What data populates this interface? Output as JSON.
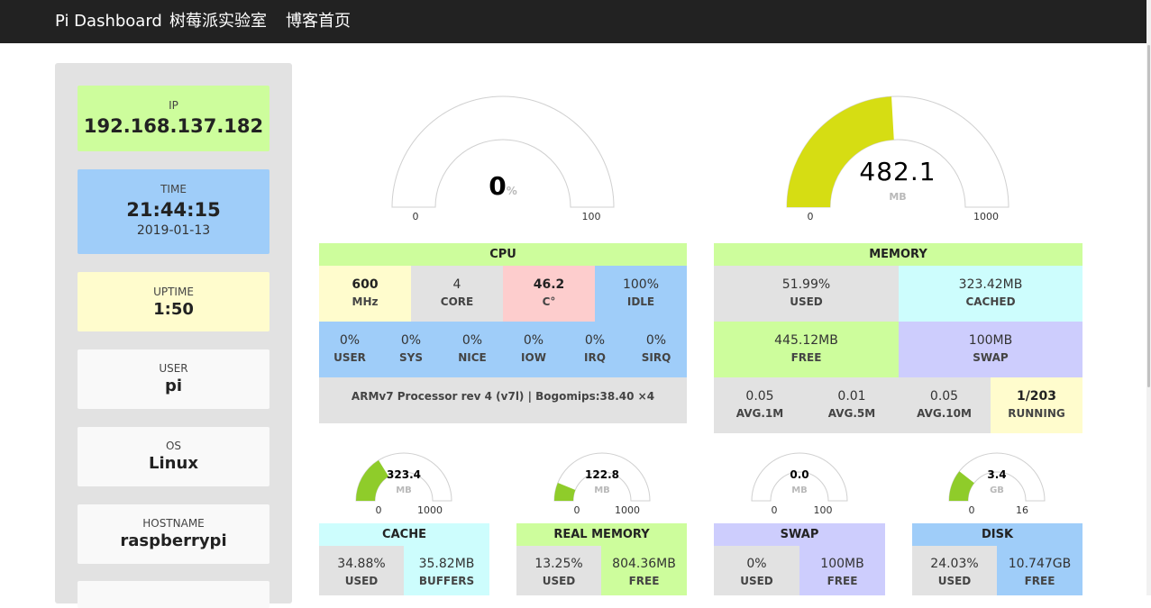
{
  "nav": {
    "brand": "Pi Dashboard",
    "links": [
      "树莓派实验室",
      "博客首页"
    ]
  },
  "sidebar": {
    "ip": {
      "label": "IP",
      "value": "192.168.137.182"
    },
    "time": {
      "label": "TIME",
      "value": "21:44:15",
      "date": "2019-01-13"
    },
    "uptime": {
      "label": "UPTIME",
      "value": "1:50"
    },
    "user": {
      "label": "USER",
      "value": "pi"
    },
    "os": {
      "label": "OS",
      "value": "Linux"
    },
    "hostname": {
      "label": "HOSTNAME",
      "value": "raspberrypi"
    }
  },
  "gauges": {
    "cpu": {
      "value": "0",
      "unit": "%",
      "min": "0",
      "max": "100",
      "fraction": 0.0
    },
    "memory": {
      "value": "482.1",
      "unit": "MB",
      "min": "0",
      "max": "1000",
      "fraction": 0.482
    },
    "cache": {
      "value": "323.4",
      "unit": "MB",
      "min": "0",
      "max": "1000",
      "fraction": 0.323
    },
    "real_memory": {
      "value": "122.8",
      "unit": "MB",
      "min": "0",
      "max": "1000",
      "fraction": 0.123
    },
    "swap": {
      "value": "0.0",
      "unit": "MB",
      "min": "0",
      "max": "100",
      "fraction": 0.0
    },
    "disk": {
      "value": "3.4",
      "unit": "GB",
      "min": "0",
      "max": "16",
      "fraction": 0.2125
    }
  },
  "cpu": {
    "title": "CPU",
    "mhz": {
      "value": "600",
      "label": "MHz"
    },
    "core": {
      "value": "4",
      "label": "CORE"
    },
    "temp": {
      "value": "46.2",
      "label": "C°"
    },
    "idle": {
      "value": "100%",
      "label": "IDLE"
    },
    "stats": [
      {
        "value": "0%",
        "label": "USER"
      },
      {
        "value": "0%",
        "label": "SYS"
      },
      {
        "value": "0%",
        "label": "NICE"
      },
      {
        "value": "0%",
        "label": "IOW"
      },
      {
        "value": "0%",
        "label": "IRQ"
      },
      {
        "value": "0%",
        "label": "SIRQ"
      }
    ],
    "model": "ARMv7 Processor rev 4 (v7l) | Bogomips:38.40 ×4"
  },
  "memory": {
    "title": "MEMORY",
    "used": {
      "value": "51.99%",
      "label": "USED"
    },
    "cached": {
      "value": "323.42MB",
      "label": "CACHED"
    },
    "free": {
      "value": "445.12MB",
      "label": "FREE"
    },
    "swap": {
      "value": "100MB",
      "label": "SWAP"
    },
    "loads": [
      {
        "value": "0.05",
        "label": "AVG.1M"
      },
      {
        "value": "0.01",
        "label": "AVG.5M"
      },
      {
        "value": "0.05",
        "label": "AVG.10M"
      }
    ],
    "running": {
      "value": "1/203",
      "label": "RUNNING"
    }
  },
  "cache": {
    "title": "CACHE",
    "used": {
      "value": "34.88%",
      "label": "USED"
    },
    "buffers": {
      "value": "35.82MB",
      "label": "BUFFERS"
    }
  },
  "real_memory": {
    "title": "REAL MEMORY",
    "used": {
      "value": "13.25%",
      "label": "USED"
    },
    "free": {
      "value": "804.36MB",
      "label": "FREE"
    }
  },
  "swap": {
    "title": "SWAP",
    "used": {
      "value": "0%",
      "label": "USED"
    },
    "free": {
      "value": "100MB",
      "label": "FREE"
    }
  },
  "disk": {
    "title": "DISK",
    "used": {
      "value": "24.03%",
      "label": "USED"
    },
    "free": {
      "value": "10.747GB",
      "label": "FREE"
    }
  },
  "colors": {
    "green": "#cdfd9c",
    "blue": "#9fcdf9",
    "yellow": "#fffccd",
    "pink": "#fdcdcd",
    "cyan": "#cdfdfd",
    "lavender": "#cdcdfd",
    "gray": "#e2e2e2",
    "gauge_large": "#d6dd13",
    "gauge_small": "#8fcc2a"
  }
}
